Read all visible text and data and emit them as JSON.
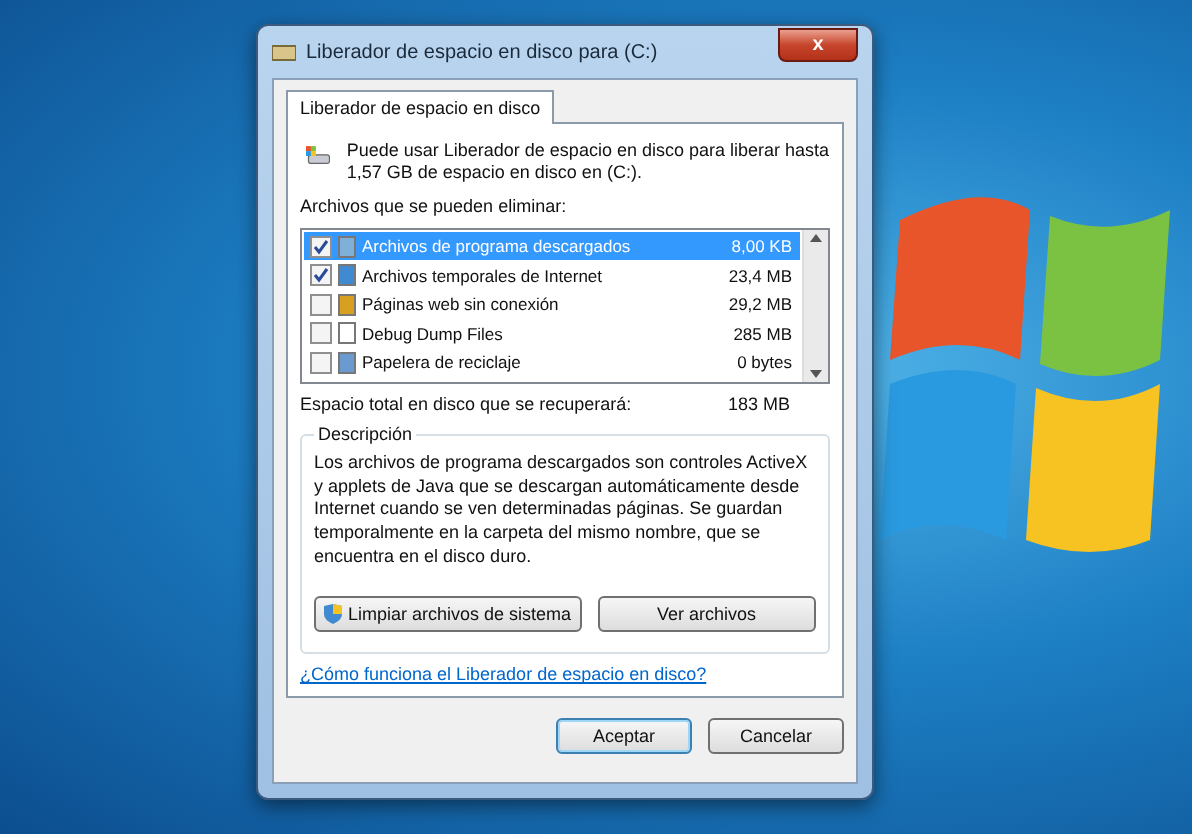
{
  "window": {
    "title": "Liberador de espacio en disco para  (C:)",
    "close": "x"
  },
  "tabs": [
    {
      "label": "Liberador de espacio en disco",
      "selected": true
    }
  ],
  "intro": "Puede usar Liberador de espacio en disco para liberar hasta 1,57 GB de espacio en disco en  (C:).",
  "files_label": "Archivos que se pueden eliminar:",
  "files": [
    {
      "name": "Archivos de programa descargados",
      "size": "8,00 KB",
      "checked": true,
      "selected": true
    },
    {
      "name": "Archivos temporales de Internet",
      "size": "23,4 MB",
      "checked": true,
      "selected": false
    },
    {
      "name": "Páginas web sin conexión",
      "size": "29,2 MB",
      "checked": false,
      "selected": false
    },
    {
      "name": "Debug Dump Files",
      "size": "285 MB",
      "checked": false,
      "selected": false
    },
    {
      "name": "Papelera de reciclaje",
      "size": "0 bytes",
      "checked": false,
      "selected": false
    }
  ],
  "total": {
    "label": "Espacio total en disco que se recuperará:",
    "value": "183 MB"
  },
  "description": {
    "title": "Descripción",
    "text": "Los archivos de programa descargados son controles ActiveX y applets de Java que se descargan automáticamente desde Internet cuando se ven determinadas páginas. Se guardan temporalmente en la carpeta del mismo nombre, que se encuentra en el disco duro."
  },
  "panel_buttons": [
    "Limpiar archivos de sistema",
    "Ver archivos"
  ],
  "help_link": "¿Cómo funciona el Liberador de espacio en disco?",
  "buttons": [
    {
      "label": "Aceptar",
      "default": true
    },
    {
      "label": "Cancelar",
      "default": false
    }
  ]
}
